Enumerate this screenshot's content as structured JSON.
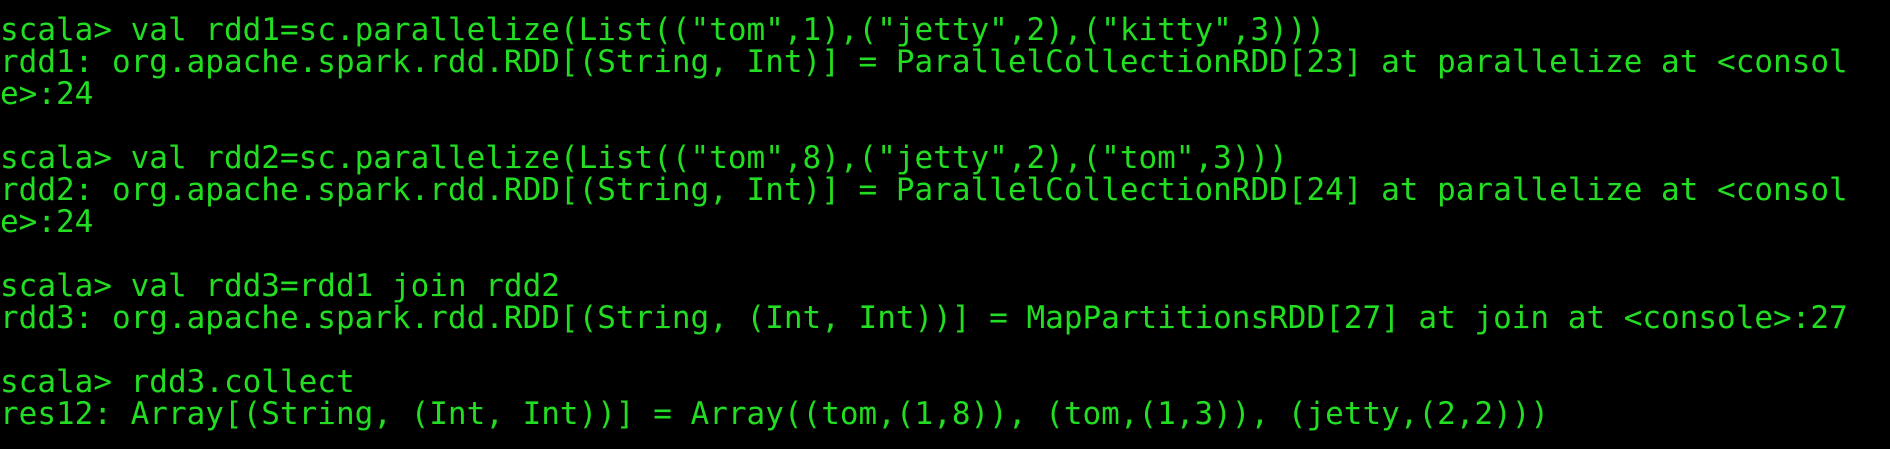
{
  "terminal": {
    "text_color": "#22dd22",
    "background_color": "#000000",
    "lines": [
      "scala> val rdd1=sc.parallelize(List((\"tom\",1),(\"jetty\",2),(\"kitty\",3)))",
      "rdd1: org.apache.spark.rdd.RDD[(String, Int)] = ParallelCollectionRDD[23] at parallelize at <consol",
      "e>:24",
      "",
      "scala> val rdd2=sc.parallelize(List((\"tom\",8),(\"jetty\",2),(\"tom\",3)))",
      "rdd2: org.apache.spark.rdd.RDD[(String, Int)] = ParallelCollectionRDD[24] at parallelize at <consol",
      "e>:24",
      "",
      "scala> val rdd3=rdd1 join rdd2",
      "rdd3: org.apache.spark.rdd.RDD[(String, (Int, Int))] = MapPartitionsRDD[27] at join at <console>:27",
      "",
      "scala> rdd3.collect",
      "res12: Array[(String, (Int, Int))] = Array((tom,(1,8)), (tom,(1,3)), (jetty,(2,2)))"
    ]
  }
}
